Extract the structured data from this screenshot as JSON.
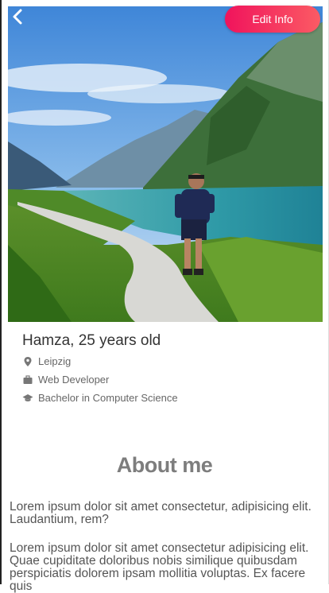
{
  "header": {
    "back_icon": "chevron-left-icon",
    "edit_label": "Edit Info",
    "accent_gradient": [
      "#f0135c",
      "#fb5b64"
    ]
  },
  "profile": {
    "name_age": "Hamza, 25 years old",
    "location": "Leipzig",
    "job": "Web Developer",
    "education": "Bachelor in Computer Science"
  },
  "about": {
    "title": "About me",
    "paragraph_1": "Lorem ipsum dolor sit amet consectetur, adipisicing elit. Laudantium, rem?",
    "paragraph_2": "Lorem ipsum dolor sit amet consectetur adipisicing elit. Quae cupiditate doloribus nobis similique quibusdam perspiciatis dolorem ipsam mollitia voluptas. Ex facere quis"
  },
  "icons": {
    "location": "map-pin-icon",
    "job": "briefcase-icon",
    "education": "graduation-cap-icon"
  }
}
